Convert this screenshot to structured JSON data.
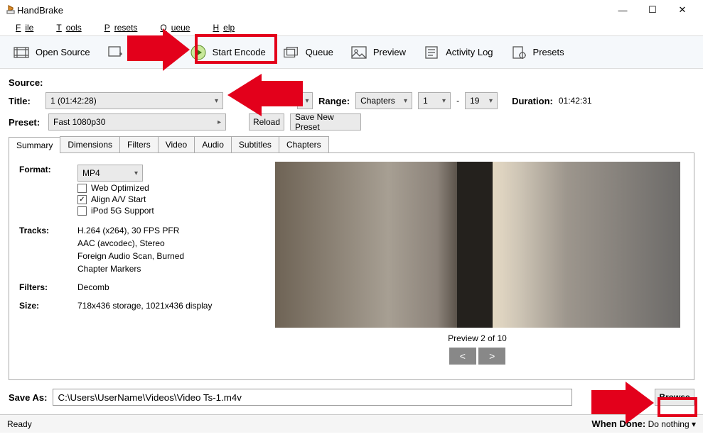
{
  "window": {
    "title": "HandBrake"
  },
  "menubar": [
    {
      "t": "File",
      "u": 0
    },
    {
      "t": "Tools",
      "u": 0
    },
    {
      "t": "Presets",
      "u": 0
    },
    {
      "t": "Queue",
      "u": 0
    },
    {
      "t": "Help",
      "u": 0
    }
  ],
  "toolbar": {
    "open_source": "Open Source",
    "start_encode": "Start Encode",
    "queue": "Queue",
    "preview": "Preview",
    "activity_log": "Activity Log",
    "presets": "Presets"
  },
  "source_label": "Source:",
  "title_label": "Title:",
  "title_value": "1  (01:42:28)",
  "range_label": "Range:",
  "range_type": "Chapters",
  "range_from": "1",
  "range_dash": "-",
  "range_to": "19",
  "duration_label": "Duration:",
  "duration_value": "01:42:31",
  "preset_label": "Preset:",
  "preset_value": "Fast 1080p30",
  "reload_btn": "Reload",
  "save_preset_btn": "Save New Preset",
  "tabs": [
    "Summary",
    "Dimensions",
    "Filters",
    "Video",
    "Audio",
    "Subtitles",
    "Chapters"
  ],
  "summary": {
    "format_label": "Format:",
    "format_value": "MP4",
    "web_opt": "Web Optimized",
    "align_av": "Align A/V Start",
    "ipod": "iPod 5G Support",
    "tracks_label": "Tracks:",
    "track1": "H.264 (x264), 30 FPS PFR",
    "track2": "AAC (avcodec), Stereo",
    "track3": "Foreign Audio Scan, Burned",
    "track4": "Chapter Markers",
    "filters_label": "Filters:",
    "filters_value": "Decomb",
    "size_label": "Size:",
    "size_value": "718x436 storage, 1021x436 display"
  },
  "preview": {
    "caption": "Preview 2 of 10",
    "prev": "<",
    "next": ">"
  },
  "saveas_label": "Save As:",
  "saveas_path": "C:\\Users\\UserName\\Videos\\Video Ts-1.m4v",
  "browse_btn": "Browse",
  "status_ready": "Ready",
  "when_done_label": "When Done:",
  "when_done_value": "Do nothing"
}
